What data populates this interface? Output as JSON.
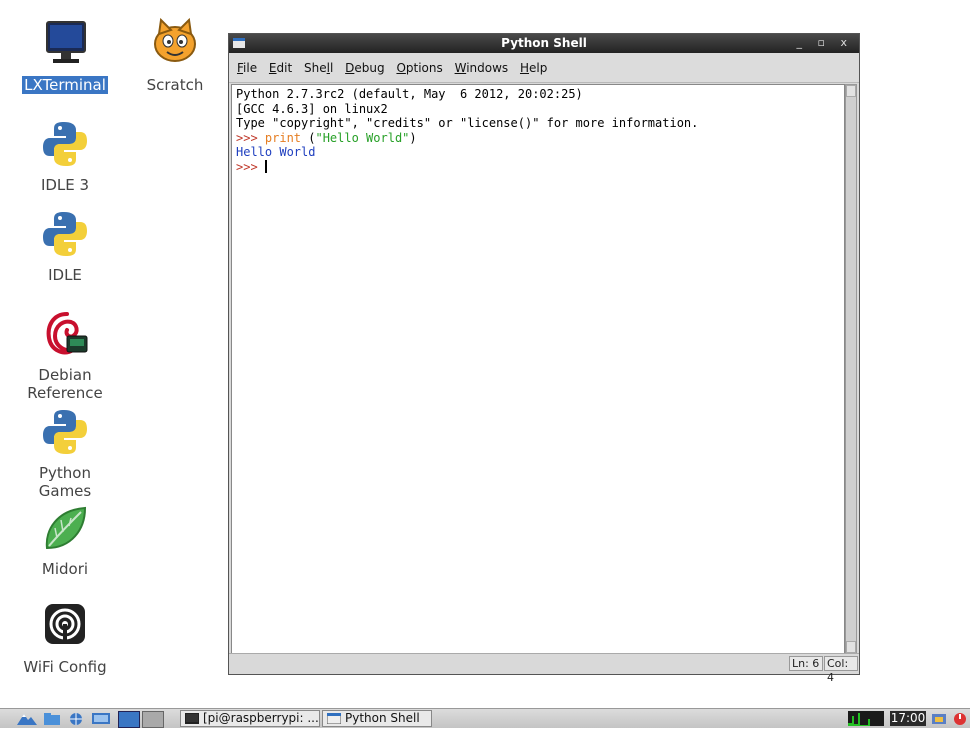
{
  "desktop": {
    "icons": [
      {
        "label": "LXTerminal",
        "selected": true,
        "icon": "monitor-icon"
      },
      {
        "label": "Scratch",
        "icon": "scratch-cat-icon"
      },
      {
        "label": "IDLE 3",
        "icon": "python-logo-icon"
      },
      {
        "label": "IDLE",
        "icon": "python-logo-icon"
      },
      {
        "label_lines": [
          "Debian",
          "Reference"
        ],
        "icon": "debian-swirl-icon"
      },
      {
        "label_lines": [
          "Python",
          "Games"
        ],
        "icon": "python-logo-icon"
      },
      {
        "label": "Midori",
        "icon": "midori-leaf-icon"
      },
      {
        "label": "WiFi Config",
        "icon": "wifi-icon"
      }
    ]
  },
  "window": {
    "title": "Python Shell",
    "controls": "_ ▫ x",
    "menu": [
      {
        "key": "F",
        "rest": "ile"
      },
      {
        "key": "E",
        "rest": "dit"
      },
      {
        "pre": "She",
        "key": "l",
        "rest": "l"
      },
      {
        "key": "D",
        "rest": "ebug"
      },
      {
        "key": "O",
        "rest": "ptions"
      },
      {
        "key": "W",
        "rest": "indows"
      },
      {
        "key": "H",
        "rest": "elp"
      }
    ],
    "shell": {
      "line1": "Python 2.7.3rc2 (default, May  6 2012, 20:02:25)",
      "line2": "[GCC 4.6.3] on linux2",
      "line3": "Type \"copyright\", \"credits\" or \"license()\" for more information.",
      "prompt": ">>> ",
      "cmd_keyword": "print",
      "cmd_open": " (",
      "cmd_string": "\"Hello World\"",
      "cmd_close": ")",
      "output": "Hello World",
      "prompt2": ">>> "
    },
    "status": {
      "ln": "Ln: 6",
      "col": "Col: 4"
    }
  },
  "taskbar": {
    "tasks": [
      {
        "label": "[pi@raspberrypi: ..."
      },
      {
        "label": "Python Shell"
      }
    ],
    "clock": "17:00"
  },
  "colors": {
    "selection": "#3a76c4",
    "prompt": "#c0392b",
    "keyword": "#e67e22",
    "string": "#27a027",
    "output": "#1f3fbf"
  }
}
